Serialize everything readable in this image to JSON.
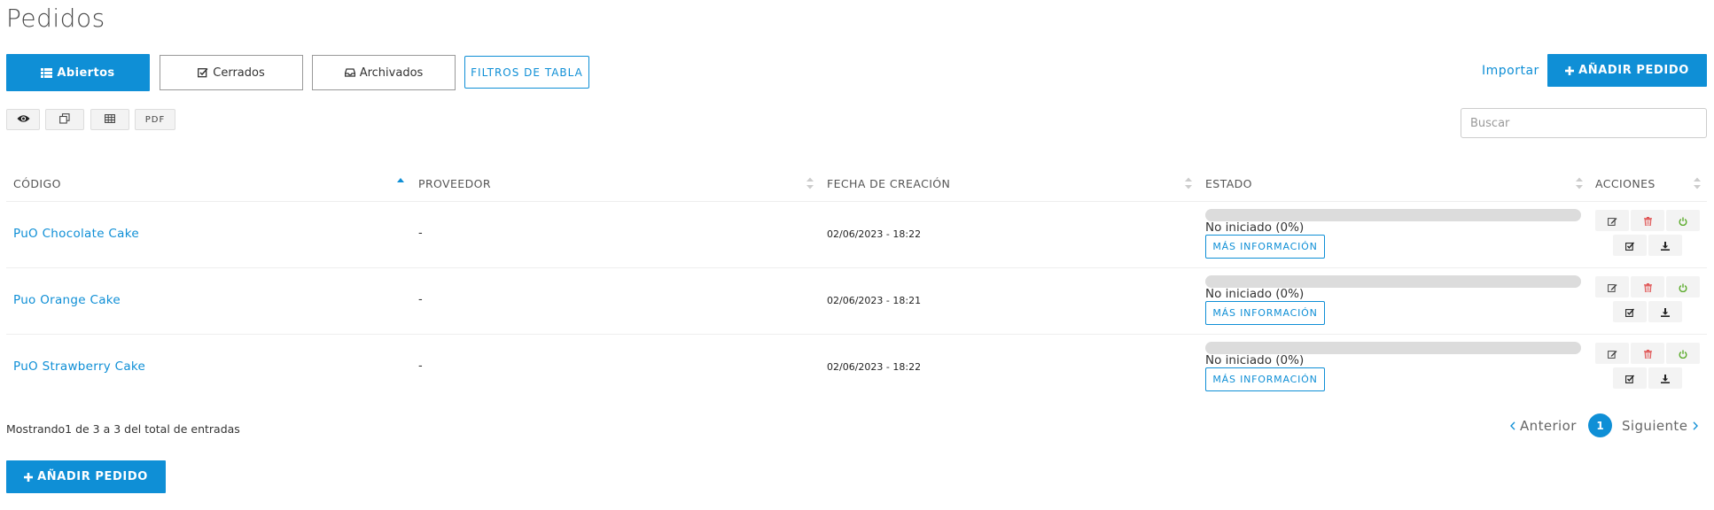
{
  "page": {
    "title": "Pedidos"
  },
  "tabs": [
    {
      "label": "Abiertos",
      "active": true
    },
    {
      "label": "Cerrados",
      "active": false
    },
    {
      "label": "Archivados",
      "active": false
    }
  ],
  "table_filters_label": "FILTROS DE TABLA",
  "import_label": "Importar",
  "add_order_label": "AÑADIR PEDIDO",
  "toolbar": {
    "pdf_label": "PDF"
  },
  "search": {
    "placeholder": "Buscar",
    "value": ""
  },
  "table": {
    "columns": [
      "CÓDIGO",
      "PROVEEDOR",
      "FECHA DE CREACIÓN",
      "ESTADO",
      "ACCIONES"
    ],
    "sorted_column": "CÓDIGO",
    "sort_direction": "asc",
    "rows": [
      {
        "code": "PuO Chocolate Cake",
        "provider": "-",
        "created": "02/06/2023 - 18:22",
        "status": "No iniciado (0%)",
        "progress": 0,
        "more_label": "MÁS INFORMACIÓN"
      },
      {
        "code": "Puo Orange Cake",
        "provider": "-",
        "created": "02/06/2023 - 18:21",
        "status": "No iniciado (0%)",
        "progress": 0,
        "more_label": "MÁS INFORMACIÓN"
      },
      {
        "code": "PuO Strawberry Cake",
        "provider": "-",
        "created": "02/06/2023 - 18:22",
        "status": "No iniciado (0%)",
        "progress": 0,
        "more_label": "MÁS INFORMACIÓN"
      }
    ]
  },
  "footer": {
    "info": "Mostrando1 de 3 a 3 del total de entradas"
  },
  "pagination": {
    "prev_label": "Anterior",
    "current": "1",
    "next_label": "Siguiente"
  },
  "colors": {
    "accent": "#0f8fd6",
    "danger": "#e05555",
    "success": "#5bab2b"
  },
  "icons": [
    "list-icon",
    "check-square-icon",
    "inbox-icon",
    "plus-icon",
    "eye-icon",
    "copy-icon",
    "table-icon",
    "sort-icon",
    "edit-icon",
    "trash-icon",
    "power-icon",
    "download-icon",
    "chevron-left-icon",
    "chevron-right-icon"
  ]
}
